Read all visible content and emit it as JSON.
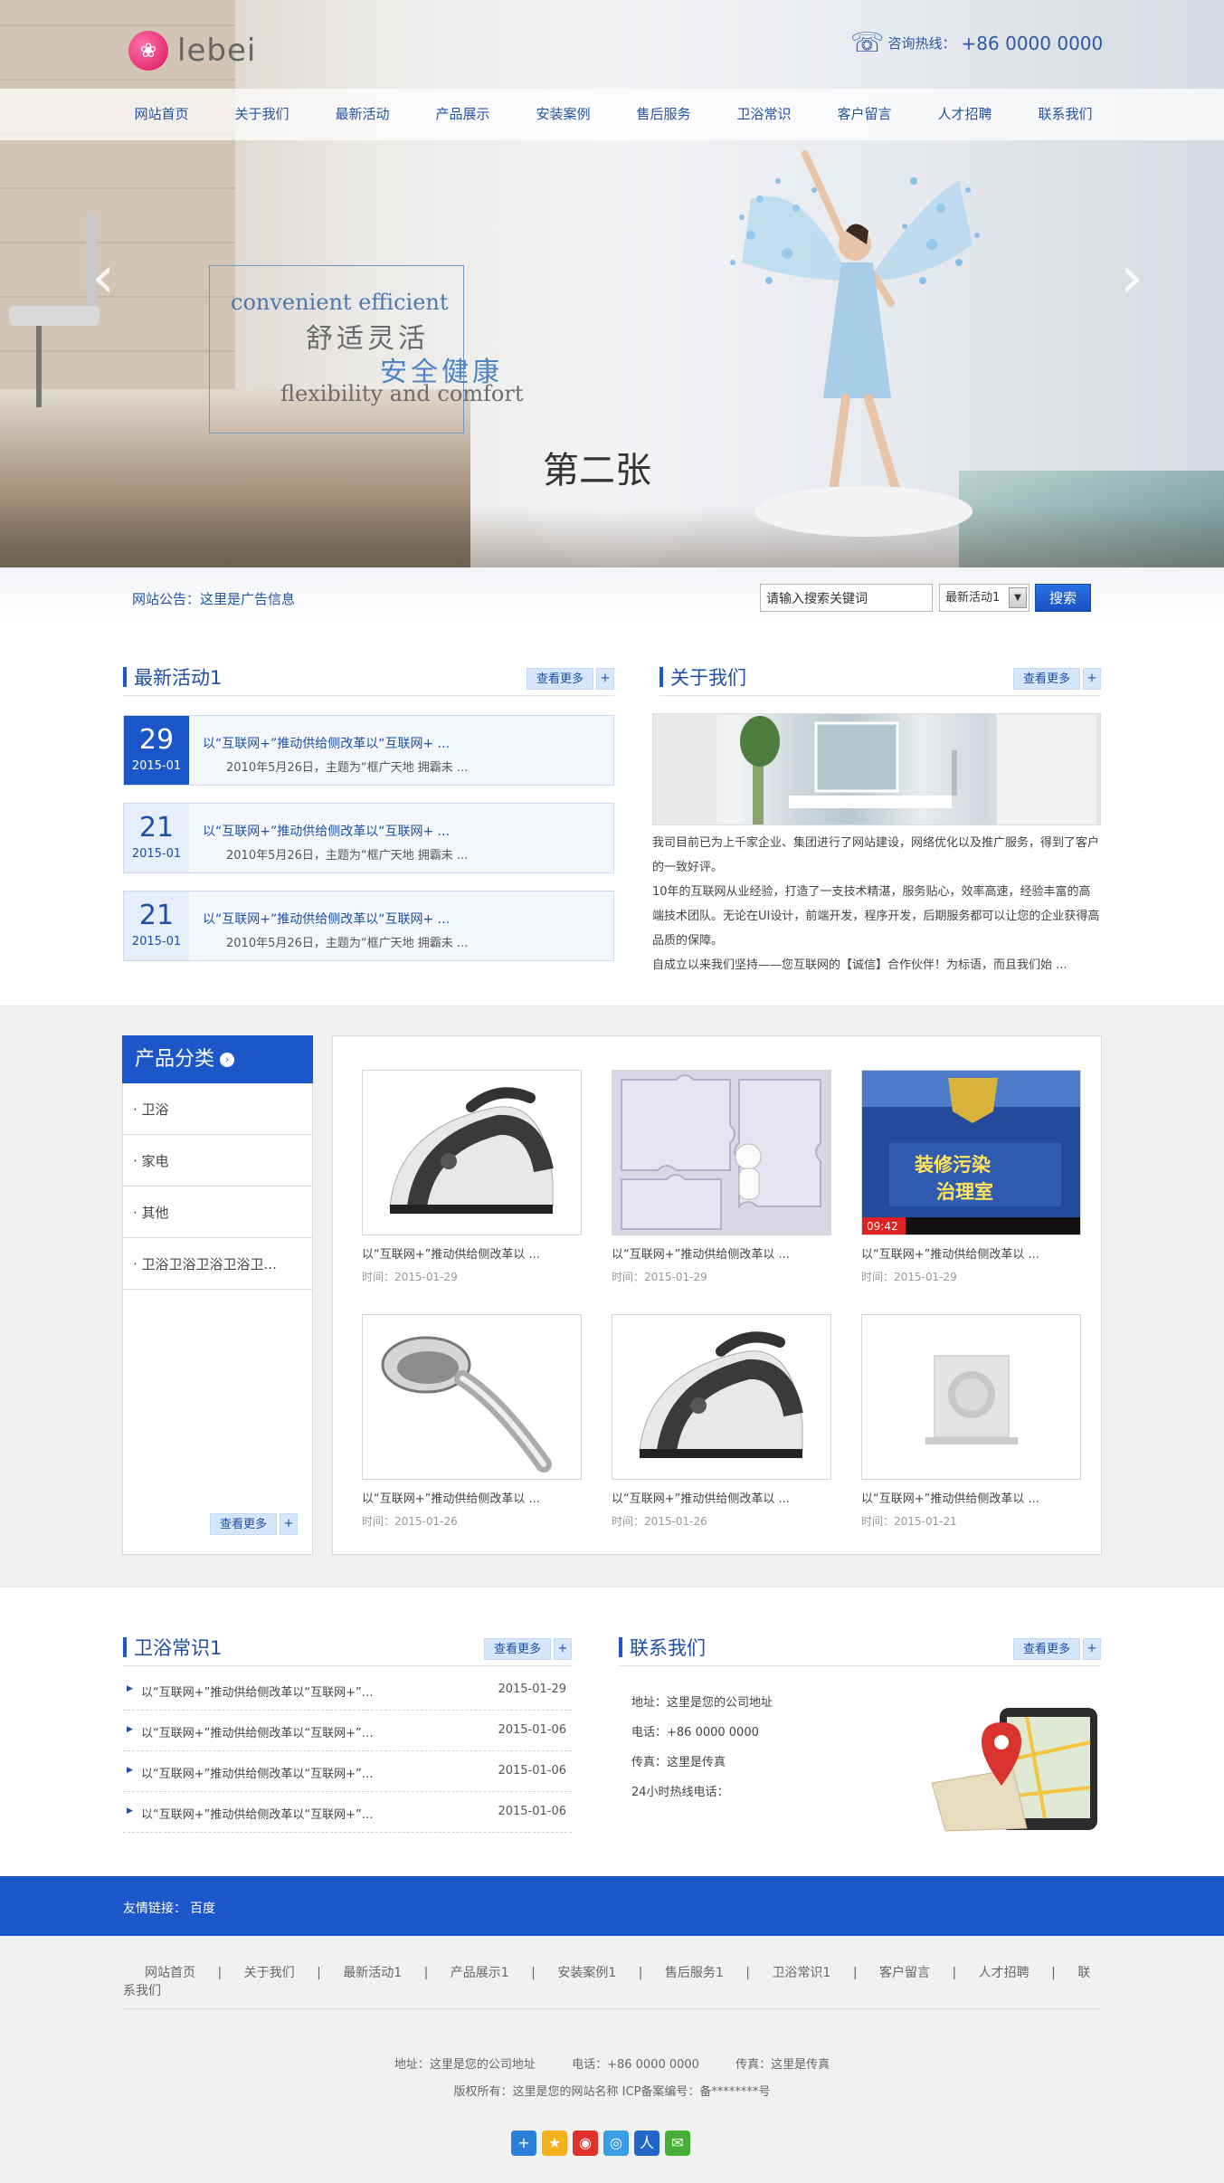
{
  "header": {
    "logo_text": "lebei",
    "hotline_label": "咨询热线：",
    "hotline_number": "+86 0000 0000"
  },
  "nav": [
    "网站首页",
    "关于我们",
    "最新活动",
    "产品展示",
    "安装案例",
    "售后服务",
    "卫浴常识",
    "客户留言",
    "人才招聘",
    "联系我们"
  ],
  "banner": {
    "en_line1": "convenient efficient",
    "cn_line1": "舒适灵活",
    "cn_line2": "安全健康",
    "en_line2": "flexibility and comfort",
    "caption": "第二张",
    "prev_glyph": "‹",
    "next_glyph": "›"
  },
  "notice": {
    "text": "网站公告：这里是广告信息"
  },
  "search": {
    "input_value": "请输入搜索关键词",
    "select_value": "最新活动1",
    "button_label": "搜索"
  },
  "more_label": "查看更多",
  "plus": "+",
  "news": {
    "title": "最新活动1",
    "items": [
      {
        "day": "29",
        "ym": "2015-01",
        "title": "以“互联网+”推动供给侧改革以“互联网+ ...",
        "summary": "2010年5月26日，主题为“框广天地 拥霸未  ..."
      },
      {
        "day": "21",
        "ym": "2015-01",
        "title": "以“互联网+”推动供给侧改革以“互联网+ ...",
        "summary": "2010年5月26日，主题为“框广天地 拥霸未  ..."
      },
      {
        "day": "21",
        "ym": "2015-01",
        "title": "以“互联网+”推动供给侧改革以“互联网+ ...",
        "summary": "2010年5月26日，主题为“框广天地 拥霸未  ..."
      }
    ]
  },
  "about": {
    "title": "关于我们",
    "p1": "我司目前已为上千家企业、集团进行了网站建设，网络优化以及推广服务，得到了客户的一致好评。",
    "p2": "10年的互联网从业经验，打造了一支技术精湛，服务贴心，效率高速，经验丰富的高端技术团队。无论在UI设计，前端开发，程序开发，后期服务都可以让您的企业获得高品质的保障。",
    "p3": "自成立以来我们坚持——您互联网的【诚信】合作伙伴！为标语，而且我们始  ..."
  },
  "categories": {
    "title": "产品分类",
    "items": [
      "· 卫浴",
      "· 家电",
      "· 其他",
      "· 卫浴卫浴卫浴卫浴卫..."
    ]
  },
  "products": [
    {
      "title": "以“互联网+”推动供给侧改革以  ...",
      "date": "时间：2015-01-29",
      "icon": "iron"
    },
    {
      "title": "以“互联网+”推动供给侧改革以  ...",
      "date": "时间：2015-01-29",
      "icon": "puzzle"
    },
    {
      "title": "以“互联网+”推动供给侧改革以  ...",
      "date": "时间：2015-01-29",
      "icon": "tv-screen"
    },
    {
      "title": "以“互联网+”推动供给侧改革以  ...",
      "date": "时间：2015-01-26",
      "icon": "shower-head"
    },
    {
      "title": "以“互联网+”推动供给侧改革以  ...",
      "date": "时间：2015-01-26",
      "icon": "iron"
    },
    {
      "title": "以“互联网+”推动供给侧改革以  ...",
      "date": "时间：2015-01-21",
      "icon": "square-shower"
    }
  ],
  "tv_image_text": {
    "line1": "装修污染",
    "line2": "治理室",
    "ticker": "09:42"
  },
  "tips": {
    "title": "卫浴常识1",
    "items": [
      {
        "text": "以“互联网+”推动供给侧改革以“互联网+”…",
        "date": "2015-01-29"
      },
      {
        "text": "以“互联网+”推动供给侧改革以“互联网+”…",
        "date": "2015-01-06"
      },
      {
        "text": "以“互联网+”推动供给侧改革以“互联网+”…",
        "date": "2015-01-06"
      },
      {
        "text": "以“互联网+”推动供给侧改革以“互联网+”…",
        "date": "2015-01-06"
      }
    ]
  },
  "contact": {
    "title": "联系我们",
    "address": "地址：这里是您的公司地址",
    "phone": "电话：+86 0000 0000",
    "fax": "传真：这里是传真",
    "hotline24": "24小时热线电话："
  },
  "friend_links": {
    "label": "友情链接：",
    "items": [
      "百度"
    ]
  },
  "footer": {
    "nav": [
      "网站首页",
      "|",
      "关于我们",
      "|",
      "最新活动1",
      "|",
      "产品展示1",
      "|",
      "安装案例1",
      "|",
      "售后服务1",
      "|",
      "卫浴常识1",
      "|",
      "客户留言",
      "|",
      "人才招聘",
      "|",
      "联系我们"
    ],
    "address": "地址：这里是您的公司地址",
    "phone": "电话：+86 0000 0000",
    "fax": "传真：这里是传真",
    "copyright": "版权所有：这里是您的网站名称 ICP备案编号：备********号"
  },
  "share_icons": [
    {
      "name": "plus-share-icon",
      "glyph": "+",
      "color": "#2a7fd8"
    },
    {
      "name": "qzone-icon",
      "glyph": "★",
      "color": "#f2b21b"
    },
    {
      "name": "weibo-icon",
      "glyph": "◉",
      "color": "#e0312a"
    },
    {
      "name": "tencent-weibo-icon",
      "glyph": "◎",
      "color": "#3b9de3"
    },
    {
      "name": "renren-icon",
      "glyph": "人",
      "color": "#2266c9"
    },
    {
      "name": "wechat-icon",
      "glyph": "✉",
      "color": "#45b035"
    }
  ]
}
